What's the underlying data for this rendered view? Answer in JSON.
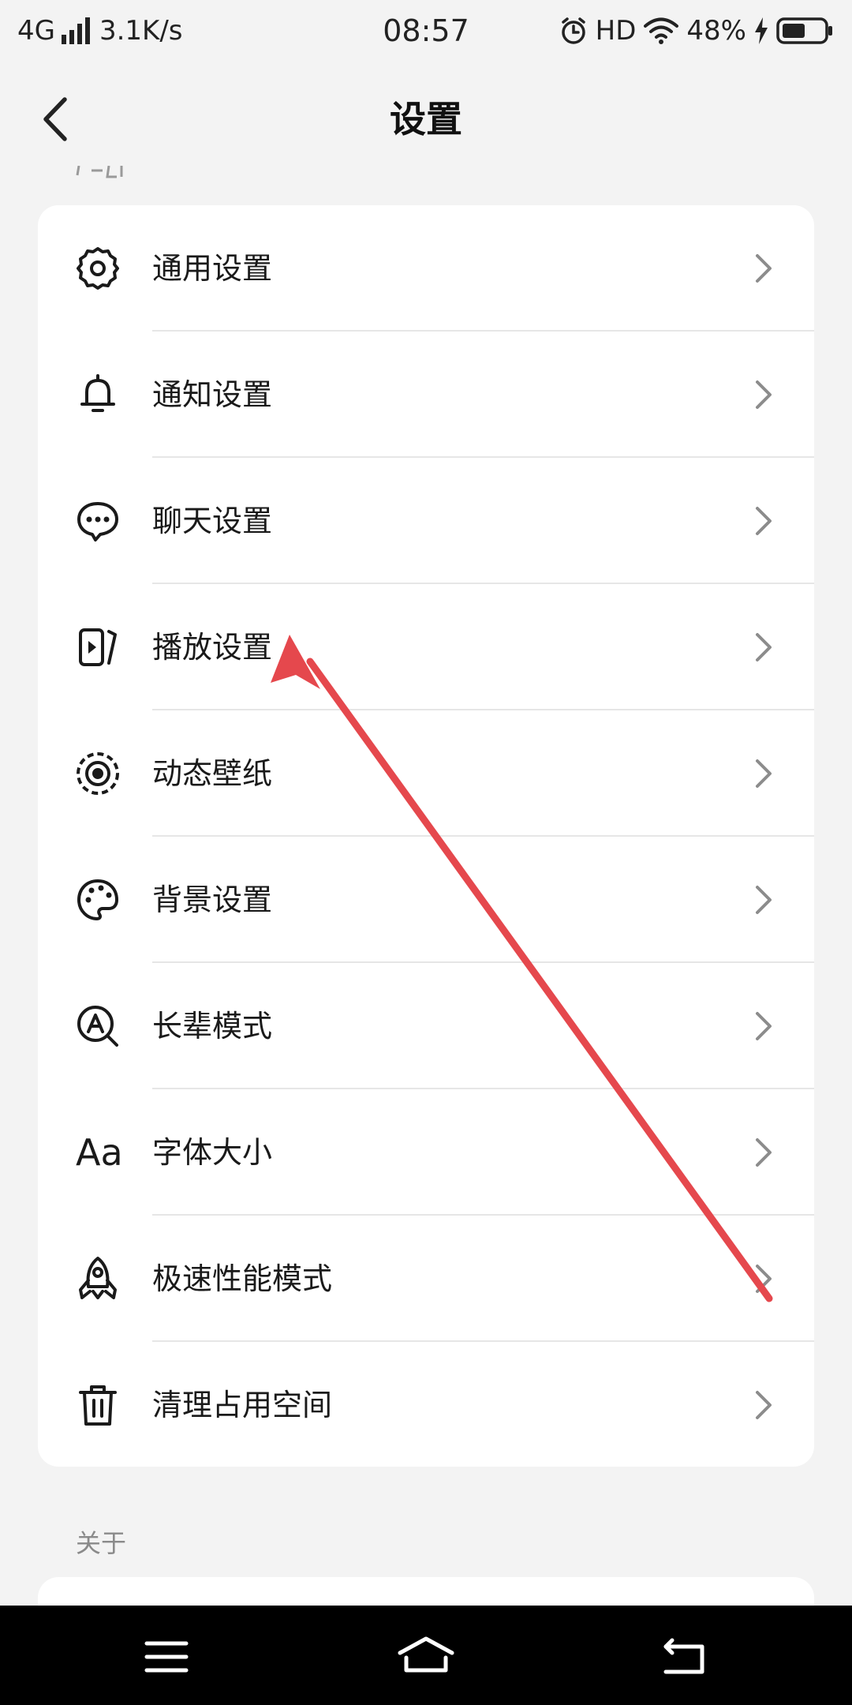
{
  "status_bar": {
    "network": "4G",
    "speed": "3.1K/s",
    "time": "08:57",
    "hd": "HD",
    "battery": "48%"
  },
  "header": {
    "title": "设置"
  },
  "general_items": [
    {
      "label": "通用设置",
      "icon": "gear-icon"
    },
    {
      "label": "通知设置",
      "icon": "bell-icon"
    },
    {
      "label": "聊天设置",
      "icon": "chat-bubble-icon"
    },
    {
      "label": "播放设置",
      "icon": "play-screen-icon"
    },
    {
      "label": "动态壁纸",
      "icon": "live-wallpaper-icon"
    },
    {
      "label": "背景设置",
      "icon": "palette-icon"
    },
    {
      "label": "长辈模式",
      "icon": "elder-mode-icon"
    },
    {
      "label": "字体大小",
      "icon": "font-size-icon",
      "glyph": "Aa"
    },
    {
      "label": "极速性能模式",
      "icon": "rocket-icon"
    },
    {
      "label": "清理占用空间",
      "icon": "trash-icon"
    }
  ],
  "about_section": {
    "title": "关于"
  },
  "colors": {
    "accent_arrow": "#e5484d",
    "card_bg": "#ffffff",
    "page_bg": "#f3f3f3"
  }
}
